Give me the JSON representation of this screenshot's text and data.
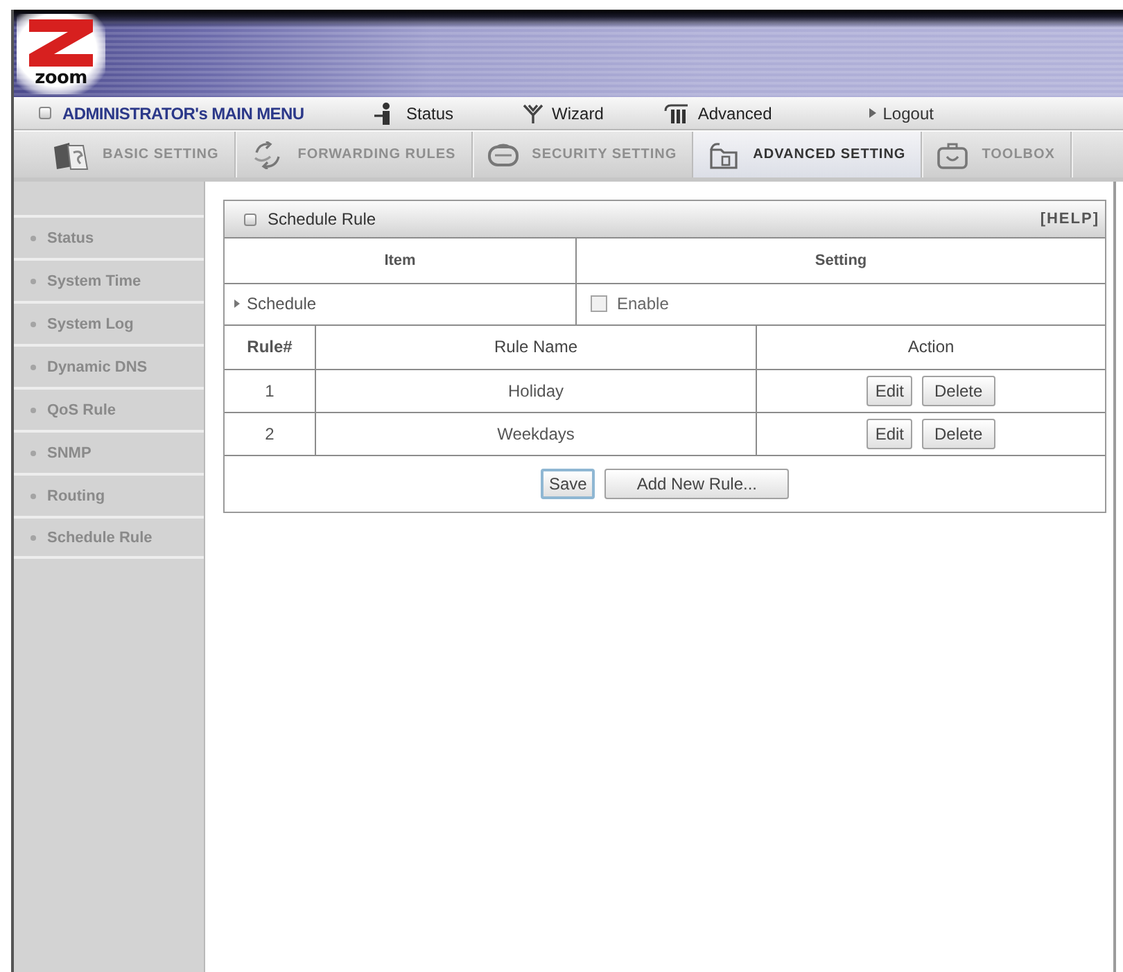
{
  "banner": {
    "logo_text": "zoom"
  },
  "main_menu": {
    "title": "ADMINISTRATOR's MAIN MENU",
    "items": [
      {
        "label": "Status",
        "kind": "status"
      },
      {
        "label": "Wizard",
        "kind": "wizard"
      },
      {
        "label": "Advanced",
        "kind": "advanced"
      },
      {
        "label": "Logout",
        "kind": "logout"
      }
    ]
  },
  "tabs": [
    {
      "label": "BASIC SETTING",
      "kind": "basic",
      "selected": false
    },
    {
      "label": "FORWARDING RULES",
      "kind": "forwarding",
      "selected": false
    },
    {
      "label": "SECURITY SETTING",
      "kind": "security",
      "selected": false
    },
    {
      "label": "ADVANCED SETTING",
      "kind": "advanced",
      "selected": true
    },
    {
      "label": "TOOLBOX",
      "kind": "toolbox",
      "selected": false
    }
  ],
  "sidebar": {
    "items": [
      {
        "label": "Status"
      },
      {
        "label": "System Time"
      },
      {
        "label": "System Log"
      },
      {
        "label": "Dynamic DNS"
      },
      {
        "label": "QoS Rule"
      },
      {
        "label": "SNMP"
      },
      {
        "label": "Routing"
      },
      {
        "label": "Schedule Rule"
      }
    ]
  },
  "panel": {
    "title": "Schedule Rule",
    "help": "[HELP]",
    "settings_table": {
      "columns": [
        "Item",
        "Setting"
      ],
      "rows": [
        {
          "item": "Schedule",
          "option": "Enable",
          "checked": false
        }
      ]
    },
    "rules_table": {
      "columns": [
        "Rule#",
        "Rule Name",
        "Action"
      ],
      "rows": [
        {
          "number": "1",
          "name": "Holiday",
          "actions": [
            "Edit",
            "Delete"
          ]
        },
        {
          "number": "2",
          "name": "Weekdays",
          "actions": [
            "Edit",
            "Delete"
          ]
        }
      ]
    },
    "buttons": [
      {
        "label": "Save",
        "focused": true
      },
      {
        "label": "Add New Rule...",
        "focused": false
      }
    ]
  }
}
